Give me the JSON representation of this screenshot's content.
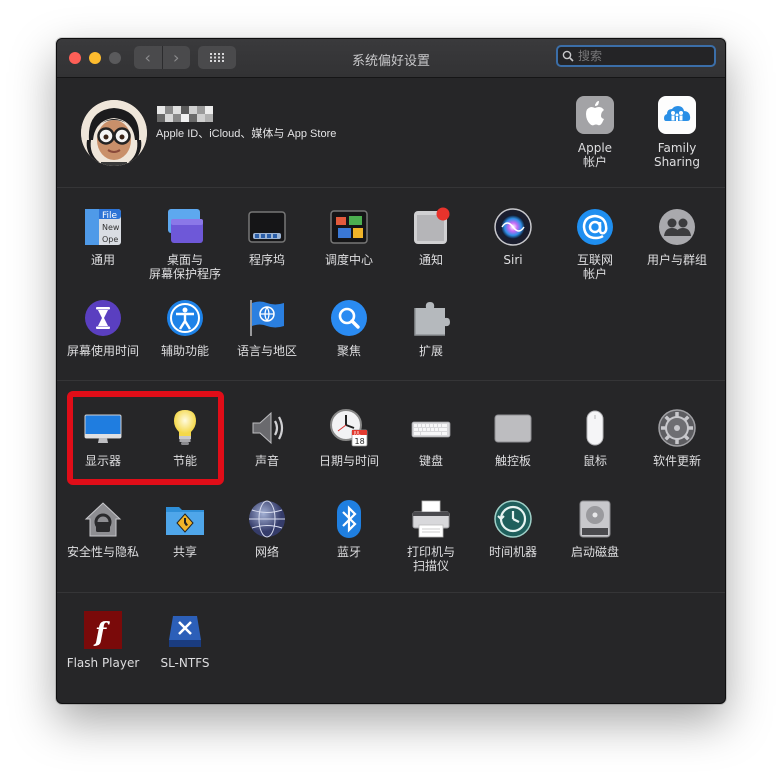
{
  "window": {
    "title": "系统偏好设置"
  },
  "toolbar": {
    "back": "‹",
    "forward": "›"
  },
  "search": {
    "placeholder": "搜索"
  },
  "account": {
    "description": "Apple ID、iCloud、媒体与 App Store"
  },
  "top_panes": [
    {
      "label": "Apple\n帐户"
    },
    {
      "label": "Family\nSharing"
    }
  ],
  "row1": [
    {
      "label": "通用"
    },
    {
      "label": "桌面与\n屏幕保护程序"
    },
    {
      "label": "程序坞"
    },
    {
      "label": "调度中心"
    },
    {
      "label": "通知"
    },
    {
      "label": "Siri"
    },
    {
      "label": "互联网\n帐户"
    },
    {
      "label": "用户与群组"
    }
  ],
  "row2": [
    {
      "label": "屏幕使用时间"
    },
    {
      "label": "辅助功能"
    },
    {
      "label": "语言与地区"
    },
    {
      "label": "聚焦"
    },
    {
      "label": "扩展"
    }
  ],
  "row3": [
    {
      "label": "显示器"
    },
    {
      "label": "节能"
    },
    {
      "label": "声音"
    },
    {
      "label": "日期与时间"
    },
    {
      "label": "键盘"
    },
    {
      "label": "触控板"
    },
    {
      "label": "鼠标"
    },
    {
      "label": "软件更新"
    }
  ],
  "row4": [
    {
      "label": "安全性与隐私"
    },
    {
      "label": "共享"
    },
    {
      "label": "网络"
    },
    {
      "label": "蓝牙"
    },
    {
      "label": "打印机与\n扫描仪"
    },
    {
      "label": "时间机器"
    },
    {
      "label": "启动磁盘"
    }
  ],
  "row5": [
    {
      "label": "Flash Player"
    },
    {
      "label": "SL-NTFS"
    }
  ],
  "icon_text": {
    "general_file": "File",
    "general_new": "New",
    "general_open": "Ope",
    "calendar_month": "JUL",
    "calendar_day": "18",
    "flash_letter": "f"
  },
  "colors": {
    "highlight": "#e00d18",
    "accent": "#3b6ea8"
  }
}
